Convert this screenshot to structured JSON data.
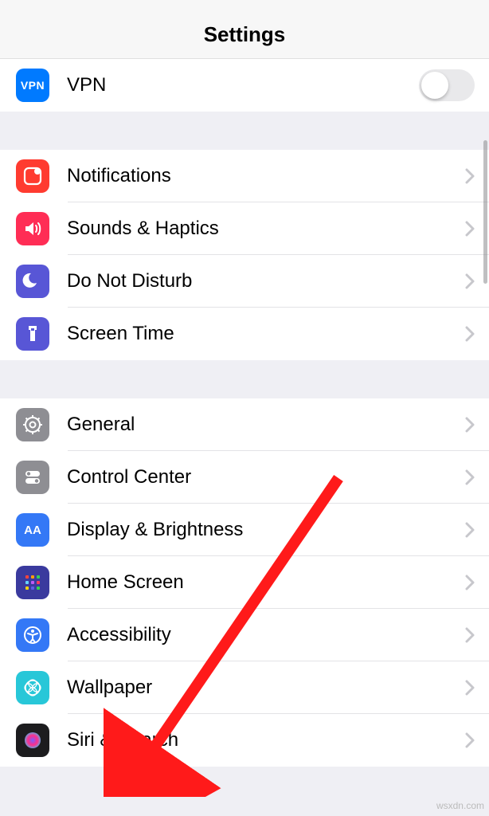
{
  "header": {
    "title": "Settings"
  },
  "vpn_group": {
    "vpn": {
      "label": "VPN",
      "badge": "VPN",
      "enabled": false
    }
  },
  "group_a": {
    "notifications": {
      "label": "Notifications"
    },
    "sounds": {
      "label": "Sounds & Haptics"
    },
    "dnd": {
      "label": "Do Not Disturb"
    },
    "screentime": {
      "label": "Screen Time"
    }
  },
  "group_b": {
    "general": {
      "label": "General"
    },
    "control": {
      "label": "Control Center"
    },
    "display": {
      "label": "Display & Brightness"
    },
    "home": {
      "label": "Home Screen"
    },
    "accessibility": {
      "label": "Accessibility"
    },
    "wallpaper": {
      "label": "Wallpaper"
    },
    "siri": {
      "label": "Siri & Search"
    }
  },
  "watermark": "wsxdn.com"
}
